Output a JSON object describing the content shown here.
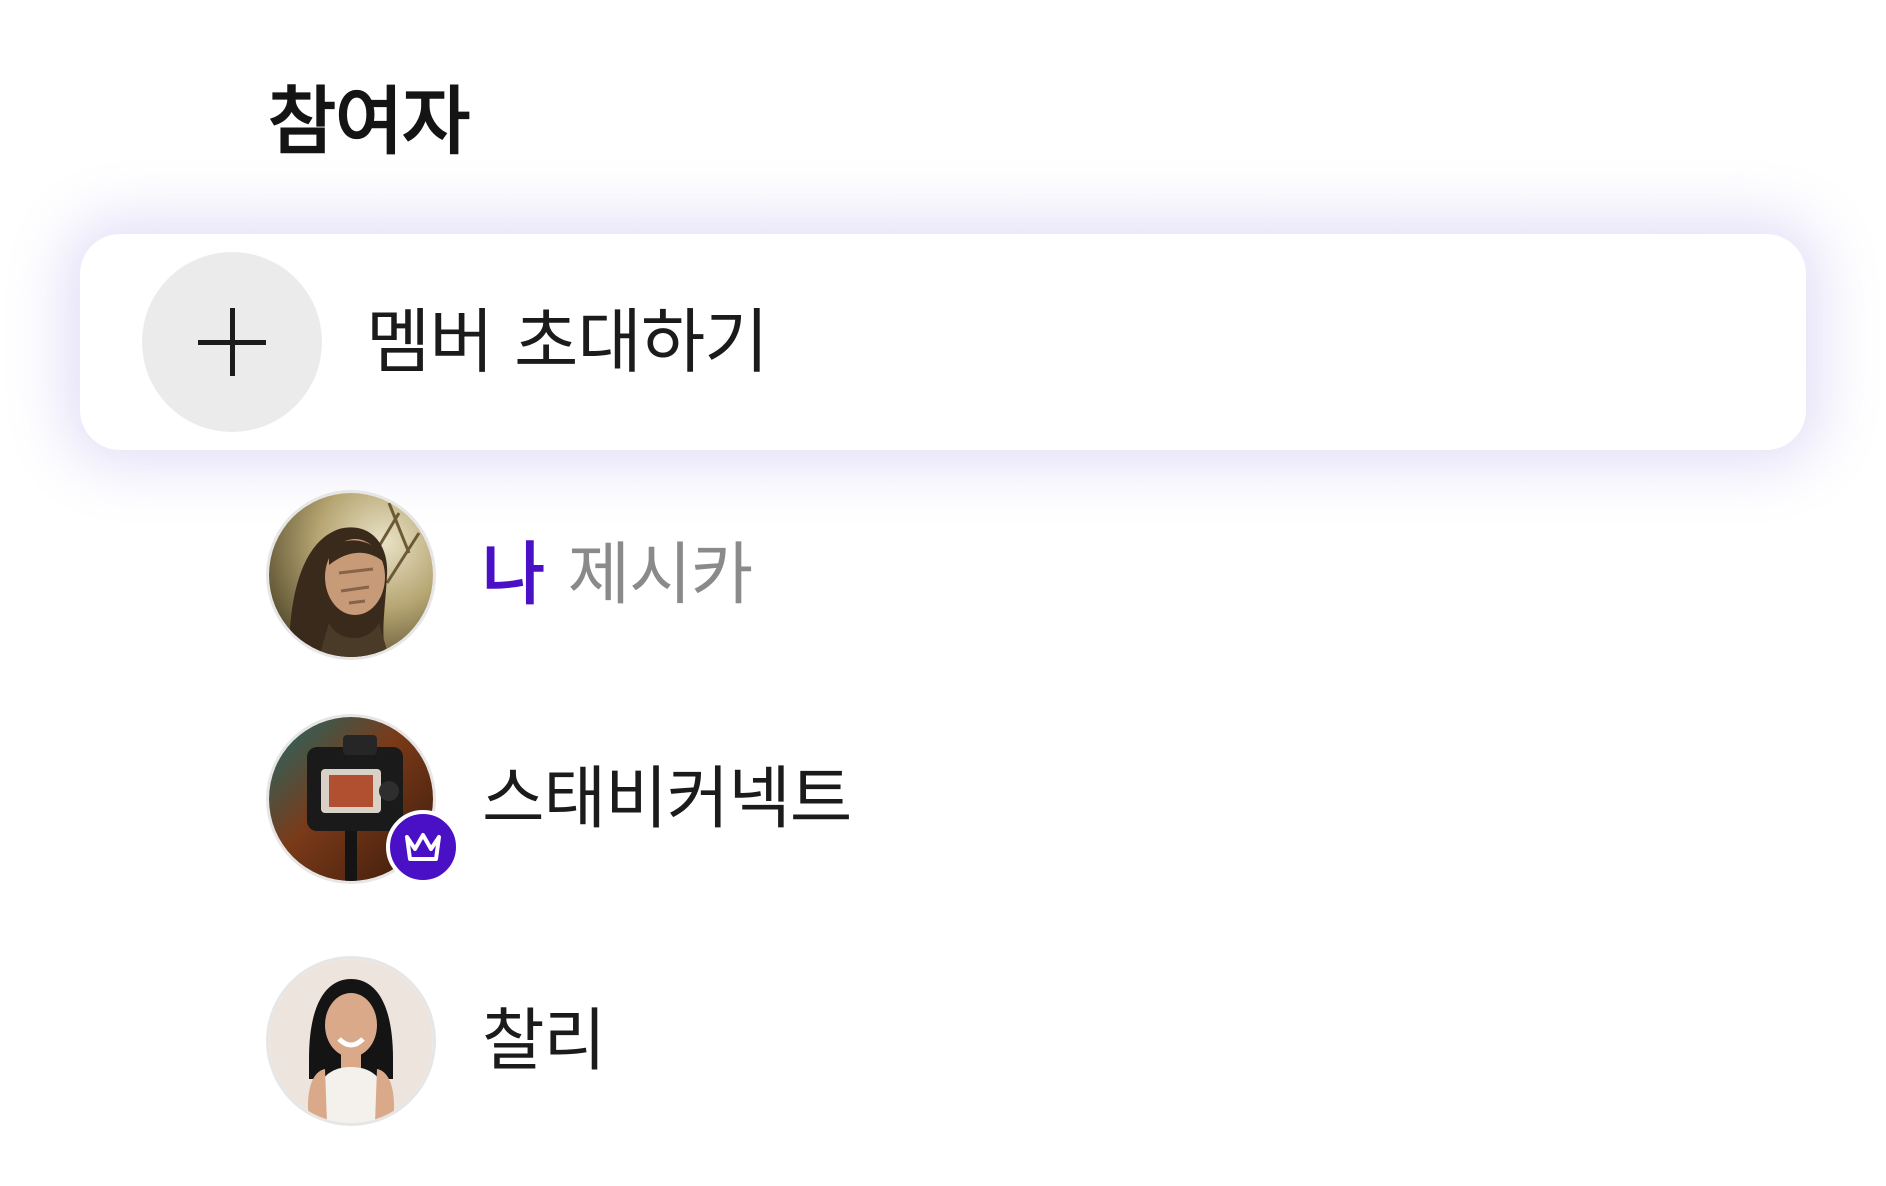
{
  "section": {
    "title": "참여자"
  },
  "invite": {
    "label": "멤버 초대하기"
  },
  "members": [
    {
      "me_tag": "나",
      "name": "제시카",
      "is_me": true,
      "is_host": false
    },
    {
      "name": "스태비커넥트",
      "is_me": false,
      "is_host": true
    },
    {
      "name": "찰리",
      "is_me": false,
      "is_host": false
    }
  ],
  "colors": {
    "accent": "#4a10c6",
    "plus_circle": "#ebebeb",
    "muted_text": "#8a8a8a",
    "card_glow": "#8c78dc"
  },
  "icons": {
    "invite": "plus-icon",
    "host_badge": "crown-icon"
  }
}
